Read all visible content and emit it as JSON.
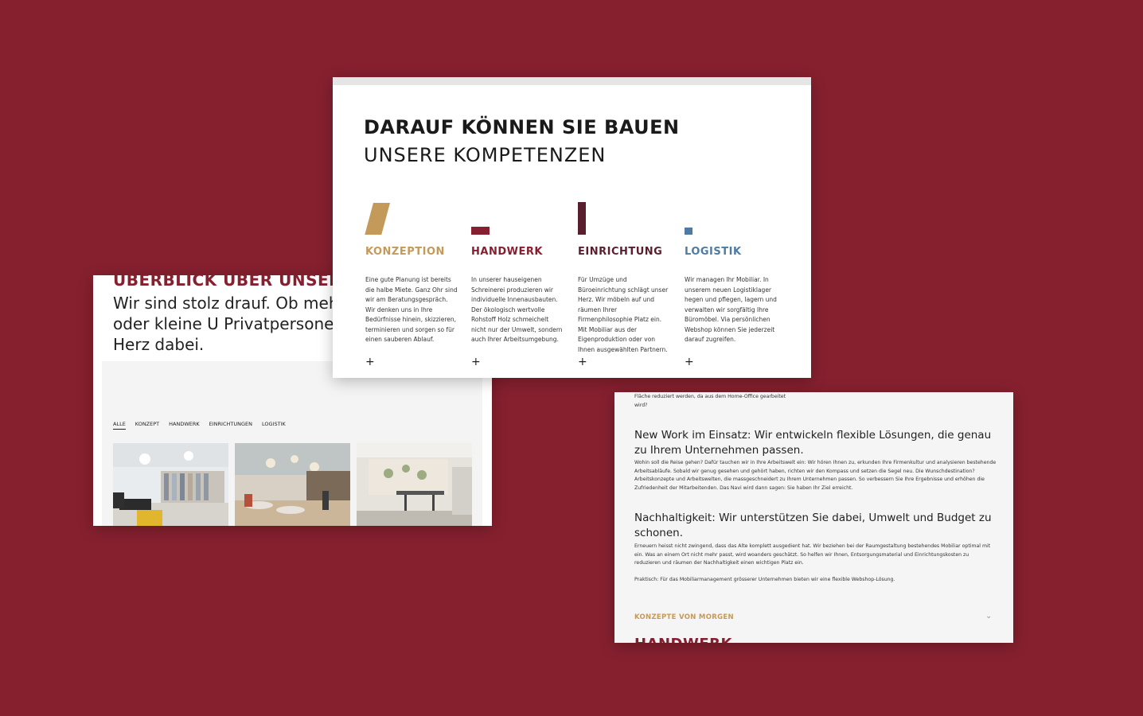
{
  "colors": {
    "background": "#86202f",
    "konzeption": "#c49a5a",
    "handwerk": "#86202f",
    "einrichtung": "#5a1f2e",
    "logistik": "#4f7ba3"
  },
  "left": {
    "heading": "ÜBERBLICK ÜBER UNSERE",
    "intro": "Wir sind stolz drauf. Ob mehr Grossprojekte oder kleine U Privatpersonen – wir sind im Herz dabei.",
    "filters": [
      "ALLE",
      "KONZEPT",
      "HANDWERK",
      "EINRICHTUNGEN",
      "LOGISTIK"
    ],
    "thumbnails": [
      "library-photo",
      "cafe-photo",
      "office-lounge-photo"
    ]
  },
  "top": {
    "title": "DARAUF KÖNNEN SIE BAUEN",
    "subtitle": "UNSERE KOMPETENZEN",
    "columns": [
      {
        "title": "KONZEPTION",
        "text": "Eine gute Planung ist bereits die halbe Miete. Ganz Ohr sind wir am Beratungsgespräch. Wir denken uns in Ihre Bedürfnisse hinein, skizzieren, terminieren und sorgen so für einen sauberen Ablauf.",
        "plus": "+"
      },
      {
        "title": "HANDWERK",
        "text": "In unserer hauseigenen Schreinerei produzieren wir individuelle Innenausbauten. Der ökologisch wertvolle Rohstoff Holz schmeichelt nicht nur der Umwelt, sondern auch Ihrer Arbeitsumgebung.",
        "plus": "+"
      },
      {
        "title": "EINRICHTUNG",
        "text": "Für Umzüge und Büroeinrichtung schlägt unser Herz. Wir möbeln auf und räumen Ihrer Firmenphilosophie Platz ein. Mit Mobiliar aus der Eigenproduktion oder von Ihnen ausgewählten Partnern.",
        "plus": "+"
      },
      {
        "title": "LOGISTIK",
        "text": "Wir managen Ihr Mobiliar. In unserem neuen Logistiklager hegen und pflegen, lagern und verwalten wir sorgfältig Ihre Büromöbel. Via persönlichen Webshop können Sie jederzeit darauf zugreifen.",
        "plus": "+"
      }
    ]
  },
  "right": {
    "top_text": "Fläche reduziert werden, da aus dem Home-Office gearbeitet wird?",
    "section1_title": "New Work im Einsatz: Wir entwickeln flexible Lösungen, die genau zu Ihrem Unternehmen passen.",
    "section1_text": "Wohin soll die Reise gehen? Dafür tauchen wir in Ihre Arbeitswelt ein: Wir hören Ihnen zu, erkunden Ihre Firmenkultur und analysieren bestehende Arbeitsabläufe. Sobald wir genug gesehen und gehört haben, richten wir den Kompass und setzen die Segel neu. Die Wunschdestination? Arbeitskonzepte und Arbeitswelten, die massgeschneidert zu Ihrem Unternehmen passen. So verbessern Sie Ihre Ergebnisse und erhöhen die Zufriedenheit der Mitarbeitenden. Das Navi wird dann sagen: Sie haben Ihr Ziel erreicht.",
    "section2_title": "Nachhaltigkeit: Wir unterstützen Sie dabei, Umwelt und Budget zu schonen.",
    "section2_text": "Erneuern heisst nicht zwingend, dass das Alte komplett ausgedient hat. Wir beziehen bei der Raumgestaltung bestehendes Mobiliar optimal mit ein. Was an einem Ort nicht mehr passt, wird woanders geschätzt. So helfen wir Ihnen, Entsorgungsmaterial und Einrichtungskosten zu reduzieren und räumen der Nachhaltigkeit einen wichtigen Platz ein.",
    "section2_note": "Praktisch: Für das Mobiliarmanagement grösserer Unternehmen bieten wir eine flexible Webshop-Lösung.",
    "accordion_label": "KONZEPTE VON MORGEN",
    "next_heading": "HANDWERK"
  }
}
